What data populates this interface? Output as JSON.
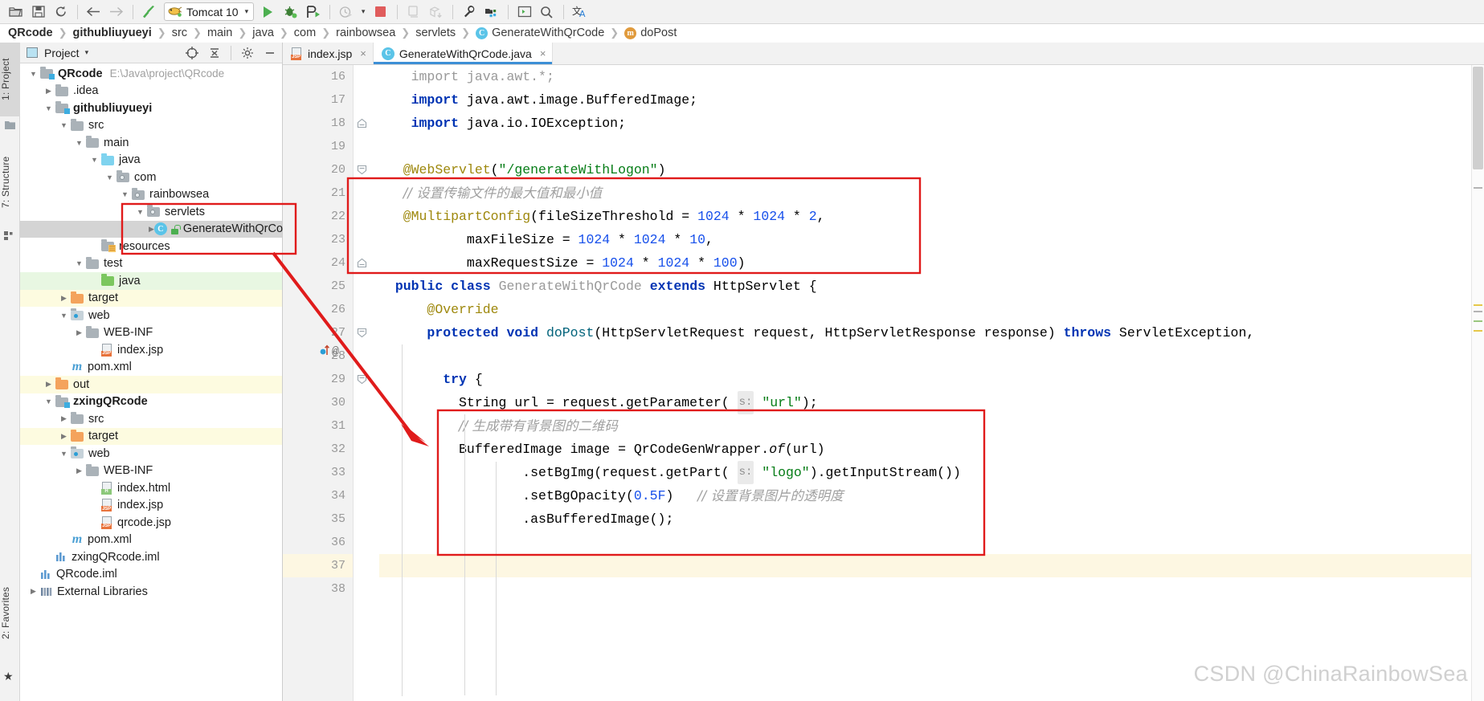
{
  "toolbar": {
    "icons": [
      {
        "name": "open-folder-icon",
        "glyph": "📂"
      },
      {
        "name": "save-all-icon",
        "glyph": "💾"
      },
      {
        "name": "sync-refresh-icon",
        "glyph": "↻"
      },
      {
        "name": "back-arrow-icon",
        "glyph": "←"
      },
      {
        "name": "forward-arrow-icon",
        "glyph": "→"
      },
      {
        "name": "build-hammer-icon",
        "glyph": "↖"
      }
    ],
    "run_config": {
      "label": "Tomcat 10",
      "cat_icon": "tomcat-cat-icon",
      "dropdown_arrow": "▾"
    },
    "run_icon": "run-play-icon",
    "debug_icon": "debug-bug-icon",
    "run_coverage_icon": "run-with-coverage-icon",
    "profiler_icon": "profiler-clock-icon",
    "profiler_arrow": "▾",
    "stop_icon": "stop-square-icon",
    "device_icon": "device-manager-icon",
    "package_icon": "package-download-icon",
    "settings_icon": "wrench-settings-icon",
    "project-structure_icon": "project-structure-icon",
    "terminal_icon": "terminal-icon",
    "search_icon": "search-magnifier-icon",
    "translate_icon": "translate-icon"
  },
  "breadcrumb": [
    {
      "label": "QRcode",
      "style": "bold",
      "icon": null
    },
    {
      "label": "githubliuyueyi",
      "style": "bold",
      "icon": null
    },
    {
      "label": "src",
      "style": "normal",
      "icon": null
    },
    {
      "label": "main",
      "style": "normal",
      "icon": null
    },
    {
      "label": "java",
      "style": "normal",
      "icon": null
    },
    {
      "label": "com",
      "style": "normal",
      "icon": null
    },
    {
      "label": "rainbowsea",
      "style": "normal",
      "icon": null
    },
    {
      "label": "servlets",
      "style": "normal",
      "icon": null
    },
    {
      "label": "GenerateWithQrCode",
      "style": "normal",
      "icon": "class-badge",
      "badge": "C"
    },
    {
      "label": "doPost",
      "style": "normal",
      "icon": "method-badge",
      "badge": "m"
    }
  ],
  "rail": {
    "tabs": [
      {
        "label": "1: Project",
        "active": true
      },
      {
        "label": "7: Structure",
        "active": false
      },
      {
        "label": "2: Favorites",
        "active": false
      }
    ],
    "favorites_star": "★"
  },
  "project_panel": {
    "title": "Project",
    "title_caret": "▾",
    "icon": "project-view-icon",
    "buttons": [
      {
        "name": "scroll-from-source-button",
        "glyph": "⊕"
      },
      {
        "name": "collapse-all-button",
        "glyph": "⤓"
      },
      {
        "name": "settings-gear-button",
        "glyph": "⚙"
      },
      {
        "name": "hide-panel-button",
        "glyph": "—"
      }
    ],
    "tree": [
      {
        "depth": 0,
        "twisty": "▼",
        "icon": "module-folder",
        "label": "QRcode",
        "bold": true,
        "path": "E:\\Java\\project\\QRcode",
        "row": "plain"
      },
      {
        "depth": 1,
        "twisty": "▶",
        "icon": "folder-gray",
        "label": ".idea",
        "bold": false,
        "path": "",
        "row": "plain"
      },
      {
        "depth": 1,
        "twisty": "▼",
        "icon": "module-folder",
        "label": "githubliuyueyi",
        "bold": true,
        "path": "",
        "row": "plain"
      },
      {
        "depth": 2,
        "twisty": "▼",
        "icon": "folder-gray",
        "label": "src",
        "bold": false,
        "path": "",
        "row": "plain"
      },
      {
        "depth": 3,
        "twisty": "▼",
        "icon": "folder-gray",
        "label": "main",
        "bold": false,
        "path": "",
        "row": "plain"
      },
      {
        "depth": 4,
        "twisty": "▼",
        "icon": "folder-blue",
        "label": "java",
        "bold": false,
        "path": "",
        "row": "plain"
      },
      {
        "depth": 5,
        "twisty": "▼",
        "icon": "package-folder",
        "label": "com",
        "bold": false,
        "path": "",
        "row": "plain"
      },
      {
        "depth": 6,
        "twisty": "▼",
        "icon": "package-folder",
        "label": "rainbowsea",
        "bold": false,
        "path": "",
        "row": "plain"
      },
      {
        "depth": 7,
        "twisty": "▼",
        "icon": "package-folder",
        "label": "servlets",
        "bold": false,
        "path": "",
        "row": "plain"
      },
      {
        "depth": 8,
        "twisty": "▶",
        "icon": "java-class",
        "label": "GenerateWithQrCo",
        "bold": false,
        "path": "",
        "row": "selected"
      },
      {
        "depth": 4,
        "twisty": "",
        "icon": "resources-folder",
        "label": "resources",
        "bold": false,
        "path": "",
        "row": "plain"
      },
      {
        "depth": 3,
        "twisty": "▼",
        "icon": "folder-gray",
        "label": "test",
        "bold": false,
        "path": "",
        "row": "plain"
      },
      {
        "depth": 4,
        "twisty": "",
        "icon": "folder-green",
        "label": "java",
        "bold": false,
        "path": "",
        "row": "green"
      },
      {
        "depth": 2,
        "twisty": "▶",
        "icon": "folder-orange",
        "label": "target",
        "bold": false,
        "path": "",
        "row": "yellow"
      },
      {
        "depth": 2,
        "twisty": "▼",
        "icon": "web-folder",
        "label": "web",
        "bold": false,
        "path": "",
        "row": "plain"
      },
      {
        "depth": 3,
        "twisty": "▶",
        "icon": "folder-gray",
        "label": "WEB-INF",
        "bold": false,
        "path": "",
        "row": "plain"
      },
      {
        "depth": 4,
        "twisty": "",
        "icon": "jsp-file",
        "label": "index.jsp",
        "bold": false,
        "path": "",
        "row": "plain"
      },
      {
        "depth": 2,
        "twisty": "",
        "icon": "maven-file",
        "label": "pom.xml",
        "bold": false,
        "path": "",
        "row": "plain"
      },
      {
        "depth": 1,
        "twisty": "▶",
        "icon": "folder-orange",
        "label": "out",
        "bold": false,
        "path": "",
        "row": "yellow"
      },
      {
        "depth": 1,
        "twisty": "▼",
        "icon": "module-folder",
        "label": "zxingQRcode",
        "bold": true,
        "path": "",
        "row": "plain"
      },
      {
        "depth": 2,
        "twisty": "▶",
        "icon": "folder-gray",
        "label": "src",
        "bold": false,
        "path": "",
        "row": "plain"
      },
      {
        "depth": 2,
        "twisty": "▶",
        "icon": "folder-orange",
        "label": "target",
        "bold": false,
        "path": "",
        "row": "yellow"
      },
      {
        "depth": 2,
        "twisty": "▼",
        "icon": "web-folder",
        "label": "web",
        "bold": false,
        "path": "",
        "row": "plain"
      },
      {
        "depth": 3,
        "twisty": "▶",
        "icon": "folder-gray",
        "label": "WEB-INF",
        "bold": false,
        "path": "",
        "row": "plain"
      },
      {
        "depth": 4,
        "twisty": "",
        "icon": "html-file",
        "label": "index.html",
        "bold": false,
        "path": "",
        "row": "plain"
      },
      {
        "depth": 4,
        "twisty": "",
        "icon": "jsp-file",
        "label": "index.jsp",
        "bold": false,
        "path": "",
        "row": "plain"
      },
      {
        "depth": 4,
        "twisty": "",
        "icon": "jsp-file",
        "label": "qrcode.jsp",
        "bold": false,
        "path": "",
        "row": "plain"
      },
      {
        "depth": 2,
        "twisty": "",
        "icon": "maven-file",
        "label": "pom.xml",
        "bold": false,
        "path": "",
        "row": "plain"
      },
      {
        "depth": 1,
        "twisty": "",
        "icon": "iml-file",
        "label": "zxingQRcode.iml",
        "bold": false,
        "path": "",
        "row": "plain"
      },
      {
        "depth": 0,
        "twisty": "",
        "icon": "iml-file",
        "label": "QRcode.iml",
        "bold": false,
        "path": "",
        "row": "plain"
      },
      {
        "depth": 0,
        "twisty": "▶",
        "icon": "libraries",
        "label": "External Libraries",
        "bold": false,
        "path": "",
        "row": "plain"
      }
    ]
  },
  "editor": {
    "tabs": [
      {
        "label": "index.jsp",
        "icon": "jsp-file-icon",
        "active": false,
        "close": "×"
      },
      {
        "label": "GenerateWithQrCode.java",
        "icon": "java-class-icon",
        "active": true,
        "close": "×"
      }
    ],
    "first_line_number": 16,
    "lines": [
      {
        "n": 16,
        "indent": 0,
        "fold": "",
        "cur": false,
        "tokens": [
          {
            "t": "    ",
            "c": ""
          },
          {
            "t": "import",
            "c": "gray"
          },
          {
            "t": " java.awt.*;",
            "c": "gray"
          }
        ]
      },
      {
        "n": 17,
        "indent": 0,
        "fold": "",
        "cur": false,
        "tokens": [
          {
            "t": "    ",
            "c": ""
          },
          {
            "t": "import",
            "c": "kw"
          },
          {
            "t": " java.awt.image.BufferedImage;",
            "c": "typ"
          }
        ]
      },
      {
        "n": 18,
        "indent": 0,
        "fold": "fold-end",
        "cur": false,
        "tokens": [
          {
            "t": "    ",
            "c": ""
          },
          {
            "t": "import",
            "c": "kw"
          },
          {
            "t": " java.io.IOException;",
            "c": "typ"
          }
        ]
      },
      {
        "n": 19,
        "indent": 0,
        "fold": "",
        "cur": false,
        "tokens": []
      },
      {
        "n": 20,
        "indent": 0,
        "fold": "fold-start",
        "cur": false,
        "tokens": [
          {
            "t": "   ",
            "c": ""
          },
          {
            "t": "@WebServlet",
            "c": "ann"
          },
          {
            "t": "(",
            "c": "typ"
          },
          {
            "t": "\"/generateWithLogon\"",
            "c": "str"
          },
          {
            "t": ")",
            "c": "typ"
          }
        ]
      },
      {
        "n": 21,
        "indent": 0,
        "fold": "",
        "cur": false,
        "tokens": [
          {
            "t": "   ",
            "c": ""
          },
          {
            "t": "// 设置传输文件的最大值和最小值",
            "c": "cmt"
          }
        ]
      },
      {
        "n": 22,
        "indent": 0,
        "fold": "",
        "cur": false,
        "tokens": [
          {
            "t": "   ",
            "c": ""
          },
          {
            "t": "@MultipartConfig",
            "c": "ann"
          },
          {
            "t": "(fileSizeThreshold = ",
            "c": "typ"
          },
          {
            "t": "1024",
            "c": "num"
          },
          {
            "t": " * ",
            "c": "typ"
          },
          {
            "t": "1024",
            "c": "num"
          },
          {
            "t": " * ",
            "c": "typ"
          },
          {
            "t": "2",
            "c": "num"
          },
          {
            "t": ",",
            "c": "typ"
          }
        ]
      },
      {
        "n": 23,
        "indent": 0,
        "fold": "",
        "cur": false,
        "tokens": [
          {
            "t": "           ",
            "c": ""
          },
          {
            "t": "maxFileSize = ",
            "c": "typ"
          },
          {
            "t": "1024",
            "c": "num"
          },
          {
            "t": " * ",
            "c": "typ"
          },
          {
            "t": "1024",
            "c": "num"
          },
          {
            "t": " * ",
            "c": "typ"
          },
          {
            "t": "10",
            "c": "num"
          },
          {
            "t": ",",
            "c": "typ"
          }
        ]
      },
      {
        "n": 24,
        "indent": 0,
        "fold": "fold-end",
        "cur": false,
        "tokens": [
          {
            "t": "           ",
            "c": ""
          },
          {
            "t": "maxRequestSize = ",
            "c": "typ"
          },
          {
            "t": "1024",
            "c": "num"
          },
          {
            "t": " * ",
            "c": "typ"
          },
          {
            "t": "1024",
            "c": "num"
          },
          {
            "t": " * ",
            "c": "typ"
          },
          {
            "t": "100",
            "c": "num"
          },
          {
            "t": ")",
            "c": "typ"
          }
        ]
      },
      {
        "n": 25,
        "indent": 0,
        "fold": "",
        "cur": false,
        "tokens": [
          {
            "t": "  ",
            "c": ""
          },
          {
            "t": "public",
            "c": "kw"
          },
          {
            "t": " ",
            "c": ""
          },
          {
            "t": "class",
            "c": "kw"
          },
          {
            "t": " ",
            "c": ""
          },
          {
            "t": "GenerateWithQrCode",
            "c": "gray"
          },
          {
            "t": " ",
            "c": ""
          },
          {
            "t": "extends",
            "c": "kw"
          },
          {
            "t": " HttpServlet {",
            "c": "typ"
          }
        ]
      },
      {
        "n": 26,
        "indent": 1,
        "fold": "",
        "cur": false,
        "tokens": [
          {
            "t": "      ",
            "c": ""
          },
          {
            "t": "@Override",
            "c": "ann"
          }
        ]
      },
      {
        "n": 27,
        "indent": 1,
        "fold": "fold-start",
        "cur": false,
        "tokens": [
          {
            "t": "      ",
            "c": ""
          },
          {
            "t": "protected",
            "c": "kw"
          },
          {
            "t": " ",
            "c": ""
          },
          {
            "t": "void",
            "c": "kw"
          },
          {
            "t": " ",
            "c": ""
          },
          {
            "t": "doPost",
            "c": "mth"
          },
          {
            "t": "(HttpServletRequest request, HttpServletResponse response) ",
            "c": "typ"
          },
          {
            "t": "throws",
            "c": "kw"
          },
          {
            "t": " ServletException,",
            "c": "typ"
          }
        ]
      },
      {
        "n": 28,
        "indent": 2,
        "fold": "",
        "cur": false,
        "tokens": []
      },
      {
        "n": 29,
        "indent": 2,
        "fold": "fold-start",
        "cur": false,
        "tokens": [
          {
            "t": "        ",
            "c": ""
          },
          {
            "t": "try",
            "c": "kw"
          },
          {
            "t": " {",
            "c": "typ"
          }
        ]
      },
      {
        "n": 30,
        "indent": 3,
        "fold": "",
        "cur": false,
        "tokens": [
          {
            "t": "          ",
            "c": ""
          },
          {
            "t": "String url = request.getParameter( ",
            "c": "typ"
          },
          {
            "t": "s:",
            "c": "hint"
          },
          {
            "t": " ",
            "c": ""
          },
          {
            "t": "\"url\"",
            "c": "str"
          },
          {
            "t": ");",
            "c": "typ"
          }
        ]
      },
      {
        "n": 31,
        "indent": 3,
        "fold": "",
        "cur": false,
        "tokens": [
          {
            "t": "          ",
            "c": ""
          },
          {
            "t": "// 生成带有背景图的二维码",
            "c": "cmt"
          }
        ]
      },
      {
        "n": 32,
        "indent": 3,
        "fold": "",
        "cur": false,
        "tokens": [
          {
            "t": "          ",
            "c": ""
          },
          {
            "t": "BufferedImage image = QrCodeGenWrapper.",
            "c": "typ"
          },
          {
            "t": "of",
            "c": "ital"
          },
          {
            "t": "(url)",
            "c": "typ"
          }
        ]
      },
      {
        "n": 33,
        "indent": 3,
        "fold": "",
        "cur": false,
        "tokens": [
          {
            "t": "                  ",
            "c": ""
          },
          {
            "t": ".setBgImg(request.getPart( ",
            "c": "typ"
          },
          {
            "t": "s:",
            "c": "hint"
          },
          {
            "t": " ",
            "c": ""
          },
          {
            "t": "\"logo\"",
            "c": "str"
          },
          {
            "t": ").getInputStream())",
            "c": "typ"
          }
        ]
      },
      {
        "n": 34,
        "indent": 3,
        "fold": "",
        "cur": false,
        "tokens": [
          {
            "t": "                  ",
            "c": ""
          },
          {
            "t": ".setBgOpacity(",
            "c": "typ"
          },
          {
            "t": "0.5F",
            "c": "num"
          },
          {
            "t": ")",
            "c": "typ"
          },
          {
            "t": "   ",
            "c": ""
          },
          {
            "t": "// 设置背景图片的透明度",
            "c": "cmt"
          }
        ]
      },
      {
        "n": 35,
        "indent": 3,
        "fold": "",
        "cur": false,
        "tokens": [
          {
            "t": "                  ",
            "c": ""
          },
          {
            "t": ".asBufferedImage();",
            "c": "typ"
          }
        ]
      },
      {
        "n": 36,
        "indent": 3,
        "fold": "",
        "cur": false,
        "tokens": []
      },
      {
        "n": 37,
        "indent": 3,
        "fold": "",
        "cur": true,
        "tokens": []
      },
      {
        "n": 38,
        "indent": 3,
        "fold": "",
        "cur": false,
        "tokens": []
      }
    ],
    "gutter_markers": {
      "line_27_icons": [
        "override-method-icon",
        "annotation-at-icon"
      ]
    }
  },
  "annotations": {
    "box_top": {
      "label": "multipart-config-highlight-box",
      "color": "#e01b1b"
    },
    "box_bottom": {
      "label": "bgimg-code-highlight-box",
      "color": "#e01b1b"
    },
    "box_tree": {
      "label": "servlet-class-highlight-box",
      "color": "#e01b1b"
    },
    "arrow": {
      "label": "tree-to-code-arrow",
      "color": "#e01b1b"
    }
  },
  "watermark": "CSDN @ChinaRainbowSea",
  "colors": {
    "accent_blue": "#3d8fd6",
    "annotation_red": "#e01b1b",
    "keyword_blue": "#0033b3",
    "string_green": "#067d17",
    "number_blue": "#1750eb",
    "annotation_gold": "#9e880d",
    "comment_gray": "#a0a0a0",
    "selection_gray": "#d4d4d4",
    "current_line_yellow": "#fdf7e2"
  }
}
